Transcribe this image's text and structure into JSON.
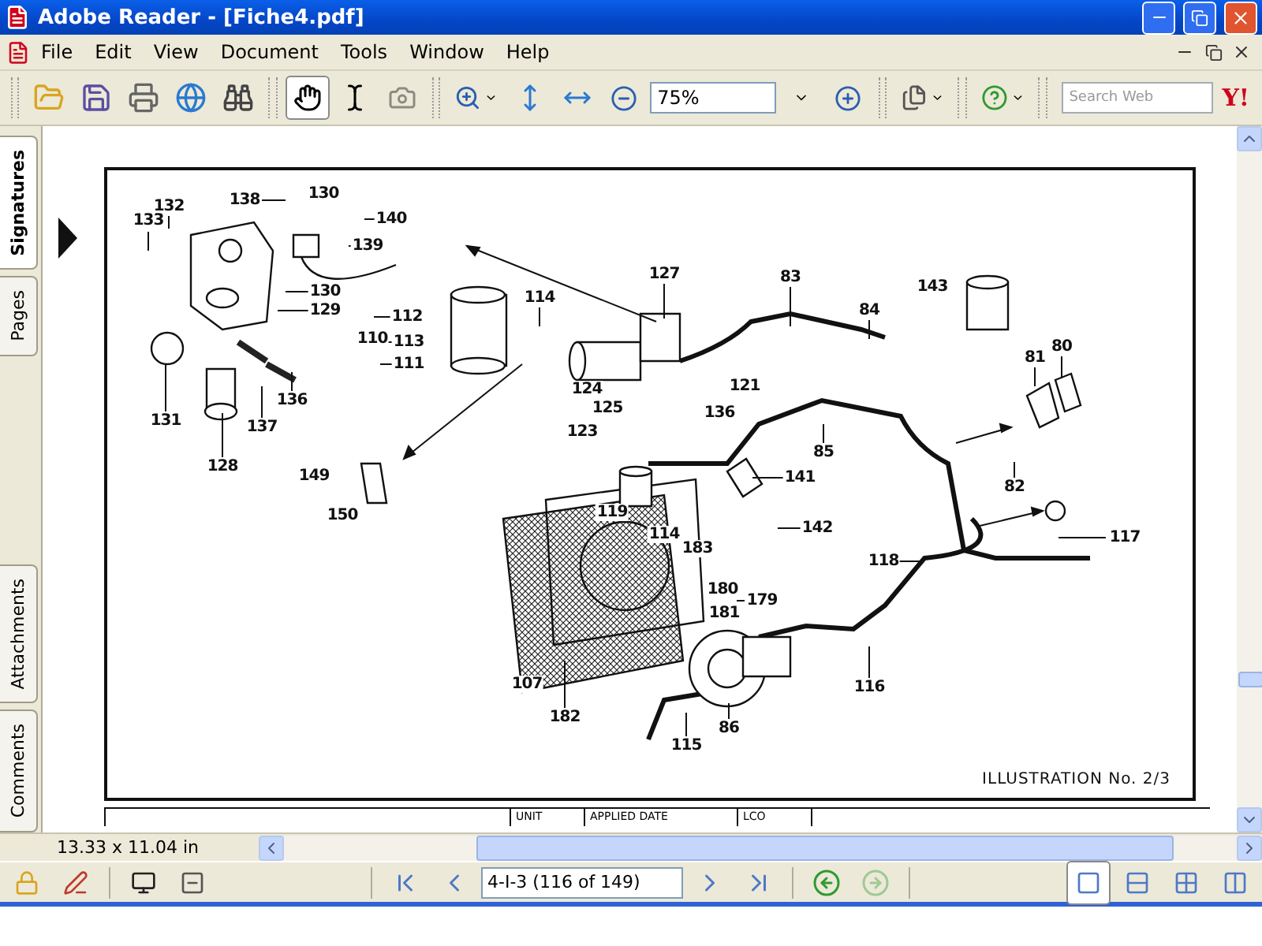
{
  "window": {
    "title": "Adobe Reader - [Fiche4.pdf]"
  },
  "menu": [
    "File",
    "Edit",
    "View",
    "Document",
    "Tools",
    "Window",
    "Help"
  ],
  "toolbar": {
    "tools": [
      {
        "kind": "hand",
        "selected": true,
        "disabled": false
      },
      {
        "kind": "select",
        "selected": false,
        "disabled": false
      },
      {
        "kind": "snapshot",
        "selected": false,
        "disabled": true
      }
    ],
    "zoom": "75%",
    "search": {
      "placeholder": "Search Web"
    },
    "logo": "Y!"
  },
  "side_tabs": [
    {
      "label": "Signatures",
      "selected": true
    },
    {
      "label": "Pages",
      "selected": false
    },
    {
      "label": "Attachments",
      "selected": false
    },
    {
      "label": "Comments",
      "selected": false
    }
  ],
  "document": {
    "callouts": [
      "130",
      "138",
      "132",
      "133",
      "140",
      "139",
      "130",
      "129",
      "112",
      "110",
      "113",
      "111",
      "114",
      "127",
      "131",
      "136",
      "137",
      "128",
      "124",
      "125",
      "123",
      "149",
      "150",
      "119",
      "114",
      "83",
      "84",
      "143",
      "136",
      "121",
      "81",
      "80",
      "85",
      "141",
      "82",
      "142",
      "117",
      "118",
      "183",
      "180",
      "179",
      "181",
      "107",
      "182",
      "86",
      "115",
      "116"
    ],
    "caption": "ILLUSTRATION No. 2/3",
    "table_headers": [
      "UNIT",
      "APPLIED DATE",
      "LCO"
    ]
  },
  "page_size": "13.33 x 11.04 in",
  "navigation": {
    "page": "4-I-3 (116 of 149)",
    "back_enabled": true,
    "forward_enabled": false
  },
  "layouts": [
    {
      "kind": "single",
      "selected": true
    },
    {
      "kind": "continuous",
      "selected": false
    },
    {
      "kind": "continuous-facing",
      "selected": false
    },
    {
      "kind": "facing",
      "selected": false
    }
  ]
}
